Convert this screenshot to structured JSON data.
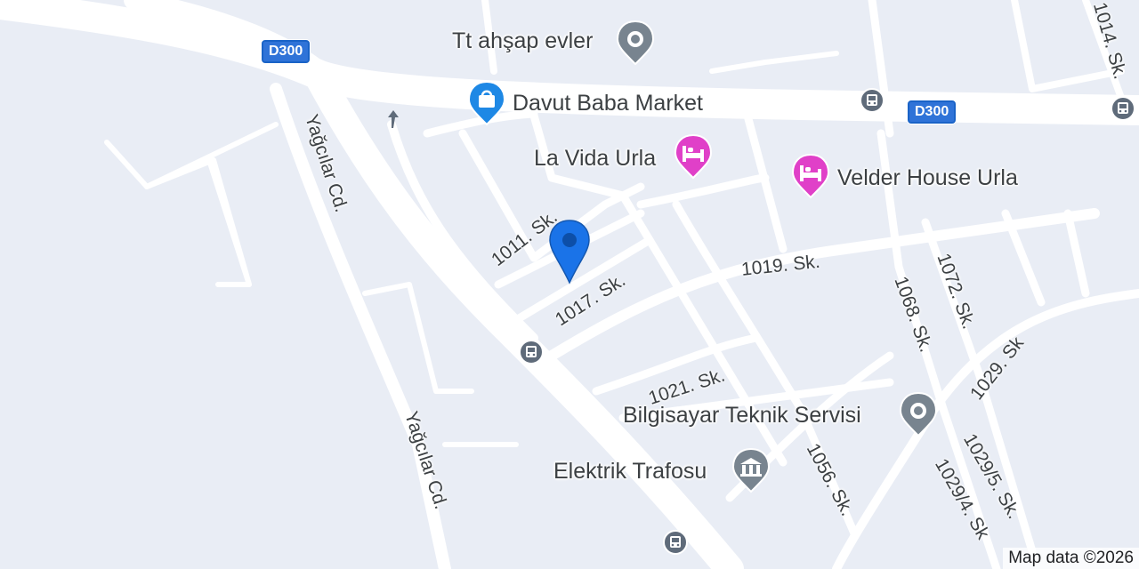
{
  "map": {
    "attribution": "Map data ©2026",
    "colors": {
      "background": "#e9edf5",
      "road": "#ffffff",
      "marker": "#1a73e8",
      "hotel": "#e040c8",
      "shopping": "#1e88e5",
      "generic_poi": "#78848f",
      "bus": "#5f6b7a",
      "highway_shield": "#2f73d8"
    },
    "highway_shields": [
      "D300",
      "D300"
    ],
    "pois": [
      {
        "name": "Tt ahşap evler",
        "icon": "pin-icon",
        "category": "generic"
      },
      {
        "name": "Davut Baba Market",
        "icon": "shopping-bag-icon",
        "category": "shopping"
      },
      {
        "name": "La Vida Urla",
        "icon": "bed-icon",
        "category": "hotel"
      },
      {
        "name": "Velder House Urla",
        "icon": "bed-icon",
        "category": "hotel"
      },
      {
        "name": "Bilgisayar Teknik Servisi",
        "icon": "pin-icon",
        "category": "generic"
      },
      {
        "name": "Elektrik Trafosu",
        "icon": "building-icon",
        "category": "generic"
      }
    ],
    "streets": [
      "1011. Sk.",
      "1017. Sk.",
      "1019. Sk.",
      "1021. Sk.",
      "1068. Sk.",
      "1072. Sk.",
      "1029. Sk",
      "1056. Sk.",
      "1029/5. Sk.",
      "1029/4. Sk",
      "1014. Sk.",
      "Yağcılar Cd.",
      "Yağcılar Cd."
    ],
    "bus_stop_icon": "bus-icon",
    "marker_icon": "location-marker-icon"
  }
}
